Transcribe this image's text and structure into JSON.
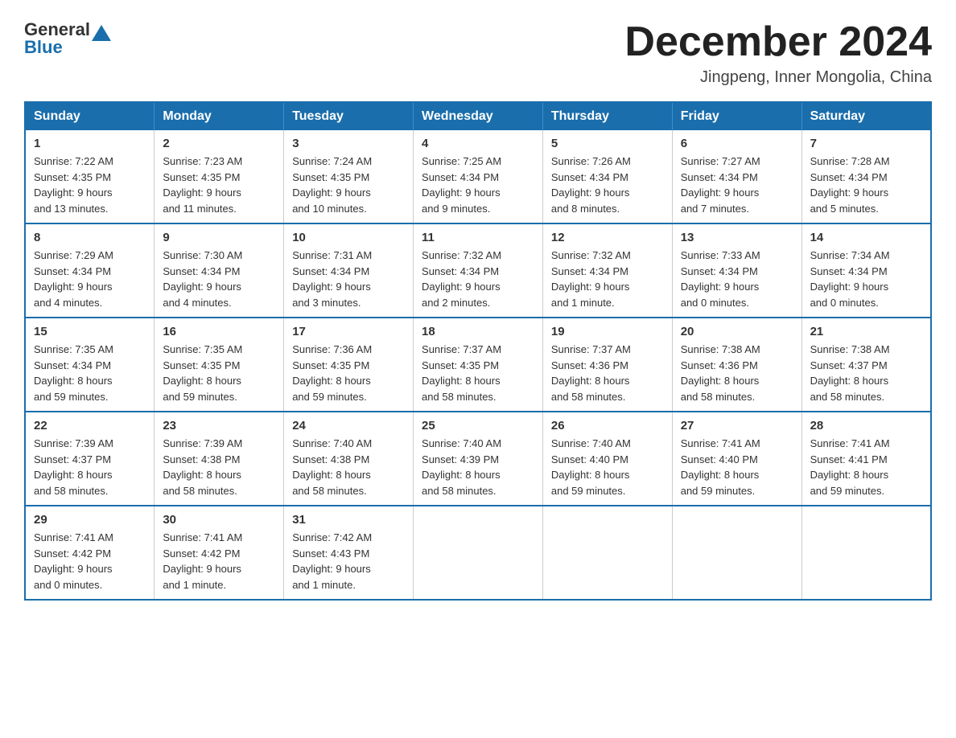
{
  "header": {
    "logo_general": "General",
    "logo_blue": "Blue",
    "month_title": "December 2024",
    "subtitle": "Jingpeng, Inner Mongolia, China"
  },
  "weekdays": [
    "Sunday",
    "Monday",
    "Tuesday",
    "Wednesday",
    "Thursday",
    "Friday",
    "Saturday"
  ],
  "weeks": [
    [
      {
        "day": "1",
        "sunrise": "7:22 AM",
        "sunset": "4:35 PM",
        "daylight": "9 hours and 13 minutes."
      },
      {
        "day": "2",
        "sunrise": "7:23 AM",
        "sunset": "4:35 PM",
        "daylight": "9 hours and 11 minutes."
      },
      {
        "day": "3",
        "sunrise": "7:24 AM",
        "sunset": "4:35 PM",
        "daylight": "9 hours and 10 minutes."
      },
      {
        "day": "4",
        "sunrise": "7:25 AM",
        "sunset": "4:34 PM",
        "daylight": "9 hours and 9 minutes."
      },
      {
        "day": "5",
        "sunrise": "7:26 AM",
        "sunset": "4:34 PM",
        "daylight": "9 hours and 8 minutes."
      },
      {
        "day": "6",
        "sunrise": "7:27 AM",
        "sunset": "4:34 PM",
        "daylight": "9 hours and 7 minutes."
      },
      {
        "day": "7",
        "sunrise": "7:28 AM",
        "sunset": "4:34 PM",
        "daylight": "9 hours and 5 minutes."
      }
    ],
    [
      {
        "day": "8",
        "sunrise": "7:29 AM",
        "sunset": "4:34 PM",
        "daylight": "9 hours and 4 minutes."
      },
      {
        "day": "9",
        "sunrise": "7:30 AM",
        "sunset": "4:34 PM",
        "daylight": "9 hours and 4 minutes."
      },
      {
        "day": "10",
        "sunrise": "7:31 AM",
        "sunset": "4:34 PM",
        "daylight": "9 hours and 3 minutes."
      },
      {
        "day": "11",
        "sunrise": "7:32 AM",
        "sunset": "4:34 PM",
        "daylight": "9 hours and 2 minutes."
      },
      {
        "day": "12",
        "sunrise": "7:32 AM",
        "sunset": "4:34 PM",
        "daylight": "9 hours and 1 minute."
      },
      {
        "day": "13",
        "sunrise": "7:33 AM",
        "sunset": "4:34 PM",
        "daylight": "9 hours and 0 minutes."
      },
      {
        "day": "14",
        "sunrise": "7:34 AM",
        "sunset": "4:34 PM",
        "daylight": "9 hours and 0 minutes."
      }
    ],
    [
      {
        "day": "15",
        "sunrise": "7:35 AM",
        "sunset": "4:34 PM",
        "daylight": "8 hours and 59 minutes."
      },
      {
        "day": "16",
        "sunrise": "7:35 AM",
        "sunset": "4:35 PM",
        "daylight": "8 hours and 59 minutes."
      },
      {
        "day": "17",
        "sunrise": "7:36 AM",
        "sunset": "4:35 PM",
        "daylight": "8 hours and 59 minutes."
      },
      {
        "day": "18",
        "sunrise": "7:37 AM",
        "sunset": "4:35 PM",
        "daylight": "8 hours and 58 minutes."
      },
      {
        "day": "19",
        "sunrise": "7:37 AM",
        "sunset": "4:36 PM",
        "daylight": "8 hours and 58 minutes."
      },
      {
        "day": "20",
        "sunrise": "7:38 AM",
        "sunset": "4:36 PM",
        "daylight": "8 hours and 58 minutes."
      },
      {
        "day": "21",
        "sunrise": "7:38 AM",
        "sunset": "4:37 PM",
        "daylight": "8 hours and 58 minutes."
      }
    ],
    [
      {
        "day": "22",
        "sunrise": "7:39 AM",
        "sunset": "4:37 PM",
        "daylight": "8 hours and 58 minutes."
      },
      {
        "day": "23",
        "sunrise": "7:39 AM",
        "sunset": "4:38 PM",
        "daylight": "8 hours and 58 minutes."
      },
      {
        "day": "24",
        "sunrise": "7:40 AM",
        "sunset": "4:38 PM",
        "daylight": "8 hours and 58 minutes."
      },
      {
        "day": "25",
        "sunrise": "7:40 AM",
        "sunset": "4:39 PM",
        "daylight": "8 hours and 58 minutes."
      },
      {
        "day": "26",
        "sunrise": "7:40 AM",
        "sunset": "4:40 PM",
        "daylight": "8 hours and 59 minutes."
      },
      {
        "day": "27",
        "sunrise": "7:41 AM",
        "sunset": "4:40 PM",
        "daylight": "8 hours and 59 minutes."
      },
      {
        "day": "28",
        "sunrise": "7:41 AM",
        "sunset": "4:41 PM",
        "daylight": "8 hours and 59 minutes."
      }
    ],
    [
      {
        "day": "29",
        "sunrise": "7:41 AM",
        "sunset": "4:42 PM",
        "daylight": "9 hours and 0 minutes."
      },
      {
        "day": "30",
        "sunrise": "7:41 AM",
        "sunset": "4:42 PM",
        "daylight": "9 hours and 1 minute."
      },
      {
        "day": "31",
        "sunrise": "7:42 AM",
        "sunset": "4:43 PM",
        "daylight": "9 hours and 1 minute."
      },
      null,
      null,
      null,
      null
    ]
  ],
  "labels": {
    "sunrise": "Sunrise:",
    "sunset": "Sunset:",
    "daylight": "Daylight:"
  }
}
